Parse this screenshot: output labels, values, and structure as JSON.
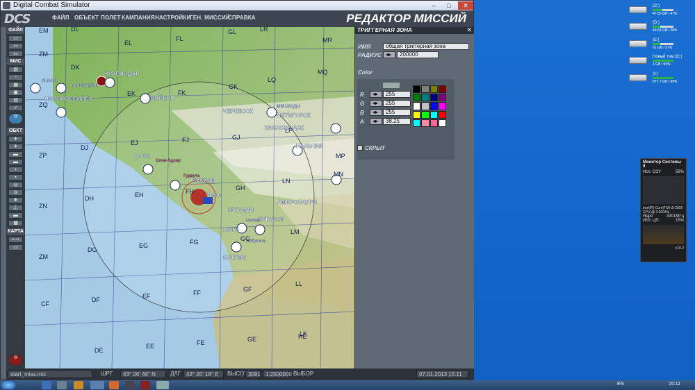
{
  "window": {
    "title": "Digital Combat Simulator"
  },
  "menu": {
    "logo": "DCS",
    "items": [
      "ФАЙЛ",
      "ОБЪЕКТ",
      "ПОЛЕТ",
      "КАМПАНИЯ",
      "НАСТРОЙКИ",
      "ГЕН. МИССИЙ",
      "СПРАВКА"
    ],
    "editor_title": "РЕДАКТОР МИССИЙ"
  },
  "left": {
    "sec_file": "ФАЙЛ",
    "sec_mis": "МИС",
    "sec_obj": "ОБКТ",
    "sec_map": "КАРТА"
  },
  "map": {
    "grid": [
      "EM",
      "DL",
      "EL",
      "FL",
      "GL",
      "LR",
      "MR",
      "ZM",
      "DK",
      "EK",
      "FK",
      "GK",
      "LQ",
      "MQ",
      "ZQ",
      "DJ",
      "EJ",
      "FJ",
      "GJ",
      "LP",
      "MP",
      "ZP",
      "DH",
      "EH",
      "FH",
      "GH",
      "LN",
      "MN",
      "ZN",
      "DG",
      "EG",
      "FG",
      "GG",
      "LM",
      "ZM",
      "DF",
      "EF",
      "FF",
      "GF",
      "LL",
      "CF",
      "DE",
      "EE",
      "FE",
      "GE",
      "LK",
      "HE"
    ],
    "cities": [
      "НОВОРОССИЙСК",
      "АНАПА",
      "КРАСНОДАР",
      "МАЙКОП",
      "ЧЕРКЕССК",
      "МИН.ВОДЫ",
      "ПЯТИГОРСК",
      "КИСЛОВОДСК",
      "НАЛЬЧИК",
      "СОЧИ",
      "СУХУМИ",
      "ЗУГДИДИ",
      "АМБРОЛАУРИ",
      "КУТАИСИ",
      "ПОТИ",
      "БАТУМИ",
      "ГЕЛЕНДЖИК",
      "Сочи-Адлер",
      "Гудаута",
      "Цель",
      "Сенаки",
      "Кобулети"
    ],
    "trigger_zone_label": "Цель"
  },
  "panel": {
    "title": "ТРИГГЕРНАЯ ЗОНА",
    "close": "✕",
    "name_label": "ИМЯ",
    "name_value": "общая триггерная зона",
    "radius_label": "РАДИУС",
    "radius_value": "200000",
    "color_label": "Color",
    "r_label": "R",
    "g_label": "G",
    "b_label": "B",
    "a_label": "A",
    "r_value": "255",
    "g_value": "255",
    "b_value": "255",
    "a_value": "38.25",
    "hidden_label": "СКРЫТ",
    "palette": [
      "#000000",
      "#808080",
      "#808000",
      "#800000",
      "#008000",
      "#008080",
      "#000080",
      "#800080",
      "#ffffff",
      "#c0c0c0",
      "#0000ff",
      "#ff00ff",
      "#ffff00",
      "#00ff00",
      "#00ffff",
      "#ff0000",
      "#00ffff",
      "#ff88aa",
      "#ff6699",
      "#ffffff"
    ]
  },
  "status": {
    "file": "start_miss.miz",
    "lat_label": "ШРТ",
    "lat": "43° 26' 46'' N",
    "lon_label": "ДЛГ",
    "lon": "42° 20' 18'' E",
    "alt_label": "ВЫСОТА",
    "alt": "3091",
    "scale": "1:2500000",
    "sel_label": "ВЫБОР",
    "date": "07.01.2013 15:11"
  },
  "desktop": {
    "drives": [
      {
        "name": "(C:)",
        "size": "47.85 GB / 47%",
        "fill": 0.47
      },
      {
        "name": "(D:)",
        "size": "49.66 GB / 38%",
        "fill": 0.38
      },
      {
        "name": "(E:)",
        "size": "61 GB / 37%",
        "fill": 0.37
      },
      {
        "name": "Новый том (G:)",
        "size": "1 GB / 99%",
        "fill": 0.99
      },
      {
        "name": "(I:)",
        "size": "877.7 GB / 99%",
        "fill": 0.99
      }
    ],
    "gadget": {
      "title": "Монитор Системы II",
      "ram_label": "Исп. ОЗУ",
      "ram": "56%",
      "cpu_name": "Intel(R) Core(TM) i5-2500",
      "cpu_freq": "CPU @ 3.30GHz",
      "cores_label": "Ядро",
      "freq": "3301МГц",
      "cpu_label": "Исп. ЦП",
      "cpu": "15%",
      "ver": "v10.2"
    },
    "lang": "EN",
    "clock": "15:11"
  }
}
